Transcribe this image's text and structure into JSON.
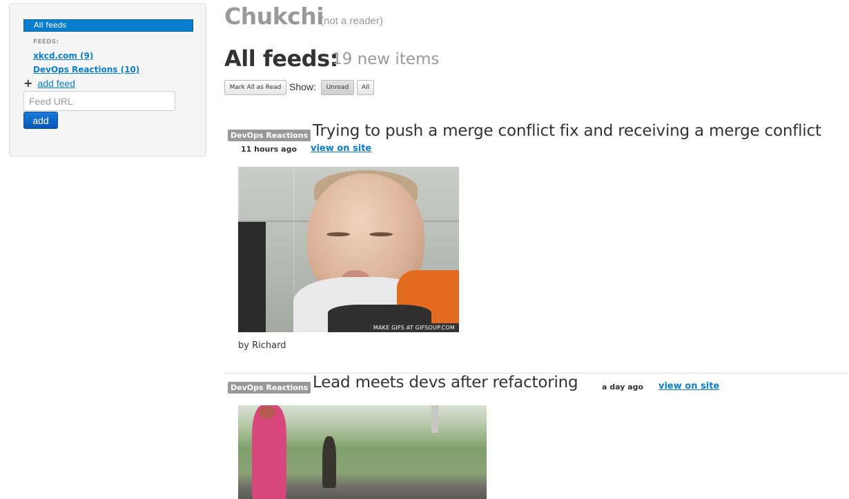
{
  "sidebar": {
    "all_feeds_label": "All feeds",
    "feeds_heading": "FEEDS:",
    "feeds": [
      {
        "label": "xkcd.com (9)"
      },
      {
        "label": "DevOps Reactions (10)"
      }
    ],
    "add_feed_label": "add feed",
    "feed_url_placeholder": "Feed URL",
    "add_button_label": "add"
  },
  "header": {
    "app_name": "Chukchi",
    "app_tagline": "(not a reader)",
    "page_title": "All feeds:",
    "new_items": "19 new items"
  },
  "toolbar": {
    "mark_all_read": "Mark All as Read",
    "show_label": "Show:",
    "filter_unread": "Unread",
    "filter_all": "All"
  },
  "entries": [
    {
      "feed": "DevOps Reactions",
      "title": "Trying to push a merge conflict fix and receiving a merge conflict",
      "time": "11 hours ago",
      "link": "view on site",
      "image_caption": "MAKE GIFS AT GIFSOUP.COM",
      "byline": "by Richard"
    },
    {
      "feed": "DevOps Reactions",
      "title": "Lead meets devs after refactoring",
      "time": "a day ago",
      "link": "view on site"
    }
  ],
  "colors": {
    "accent": "#0a7fd0",
    "badge": "#999999",
    "muted_text": "#999999"
  }
}
